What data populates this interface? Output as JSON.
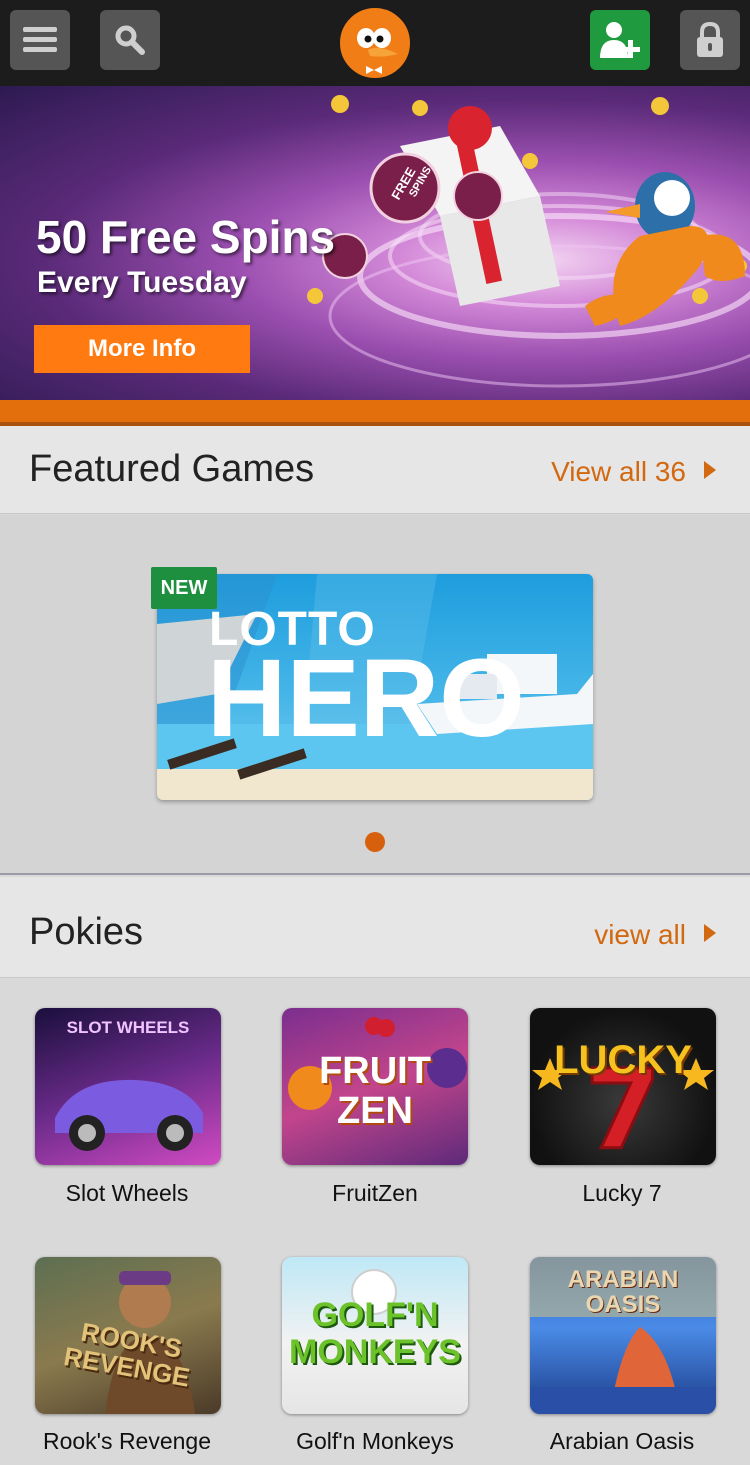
{
  "topbar": {
    "menu_icon": "hamburger-icon",
    "search_icon": "search-icon",
    "logo_icon": "bird-mascot-logo",
    "register_icon": "add-user-icon",
    "login_icon": "lock-icon"
  },
  "hero": {
    "title": "50 Free Spins",
    "subtitle": "Every Tuesday",
    "button_label": "More Info",
    "token_text_1": "FREE",
    "token_text_2": "SPINS"
  },
  "featured": {
    "title": "Featured Games",
    "link_label": "View all 36",
    "card": {
      "badge": "NEW",
      "line1": "LOTTO",
      "line2": "HERO"
    },
    "pagination": {
      "current": 1,
      "total": 1
    }
  },
  "pokies": {
    "title": "Pokies",
    "link_label": "view all",
    "games": [
      {
        "label": "Slot Wheels",
        "art_text": "SLOT WHEELS"
      },
      {
        "label": "FruitZen",
        "art_text": "FRUIT ZEN"
      },
      {
        "label": "Lucky 7",
        "art_text": "LUCKY"
      },
      {
        "label": "Rook's Revenge",
        "art_text": "ROOK'S REVENGE"
      },
      {
        "label": "Golf'n Monkeys",
        "art_text": "GOLF'N MONKEYS"
      },
      {
        "label": "Arabian Oasis",
        "art_text": "ARABIAN OASIS"
      }
    ]
  },
  "colors": {
    "accent": "#d2680f",
    "button": "#ff7a10",
    "register_green": "#1f9a3e",
    "topbar": "#1c1c1c"
  }
}
